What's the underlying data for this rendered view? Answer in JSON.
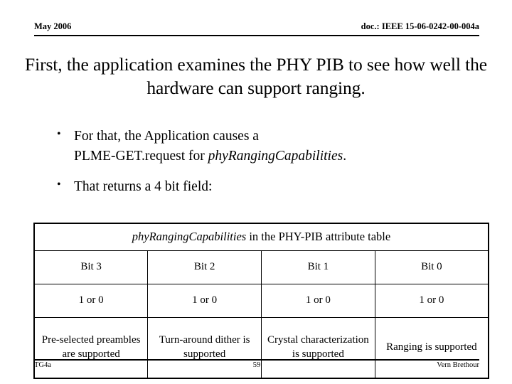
{
  "header": {
    "left": "May 2006",
    "right": "doc.: IEEE 15-06-0242-00-004a"
  },
  "title": {
    "line1": "First, the application examines the PHY PIB to see",
    "line2": "how well the hardware can support ranging."
  },
  "bullets": [
    {
      "marker": "•",
      "line1": "For that, the Application causes a",
      "line2_plain": "PLME-GET.request for ",
      "line2_italic": "phyRangingCapabilities",
      "line2_tail": "."
    },
    {
      "marker": "•",
      "text": "That returns a 4 bit field:"
    }
  ],
  "table": {
    "caption_italic": "phyRangingCapabilities",
    "caption_plain": " in the PHY-PIB attribute table",
    "bit_labels": [
      "Bit 3",
      "Bit 2",
      "Bit 1",
      "Bit 0"
    ],
    "values": [
      "1 or 0",
      "1 or 0",
      "1 or 0",
      "1 or 0"
    ],
    "descriptions": [
      "Pre-selected preambles are supported",
      "Turn-around dither is supported",
      "Crystal characterization is supported",
      "Ranging is supported"
    ]
  },
  "footer": {
    "left": "TG4a",
    "center": "59",
    "right": "Vern Brethour"
  }
}
